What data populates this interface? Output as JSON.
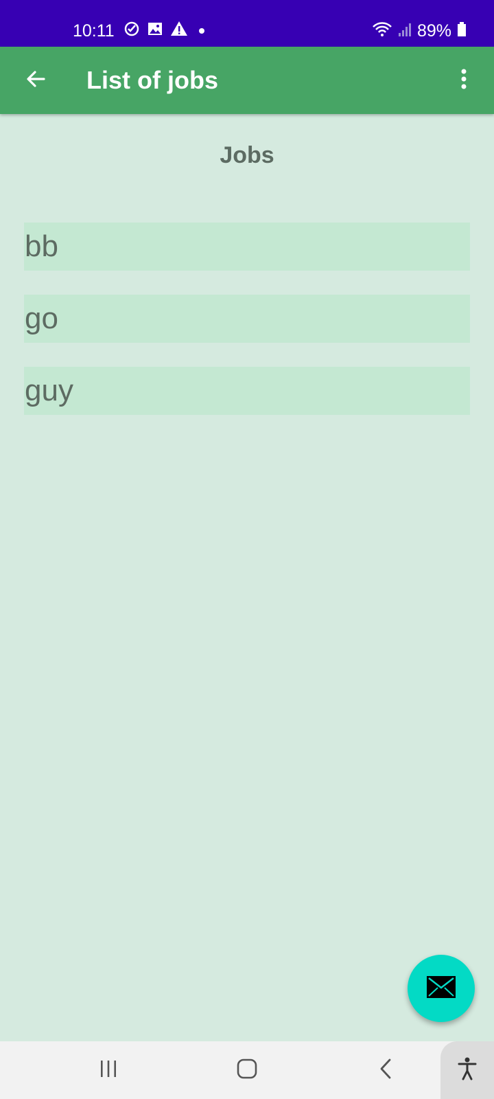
{
  "status_bar": {
    "time": "10:11",
    "battery": "89%",
    "icons_left": [
      "check-circle-icon",
      "image-icon",
      "warning-icon",
      "dot-icon"
    ],
    "icons_right": [
      "wifi-icon",
      "signal-icon",
      "battery-icon"
    ]
  },
  "app_bar": {
    "title": "List of jobs",
    "back_icon": "arrow-back-icon",
    "menu_icon": "more-vert-icon"
  },
  "content": {
    "section_title": "Jobs",
    "jobs": [
      {
        "label": "bb"
      },
      {
        "label": "go"
      },
      {
        "label": "guy"
      }
    ]
  },
  "fab": {
    "icon": "mail-icon"
  },
  "nav_bar": {
    "icons": [
      "recents-icon",
      "home-icon",
      "back-icon",
      "accessibility-icon"
    ]
  },
  "colors": {
    "status_bar": "#3700b3",
    "app_bar": "#47a565",
    "background": "#d5eadf",
    "list_item": "#c4e8d2",
    "fab": "#03dac5"
  }
}
